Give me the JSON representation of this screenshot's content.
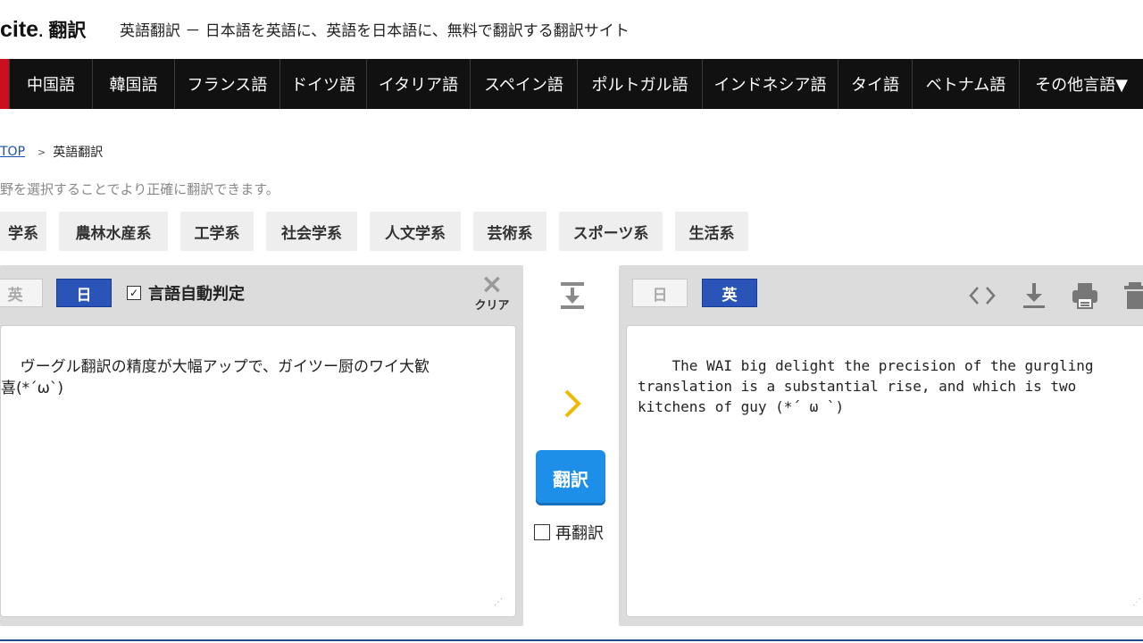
{
  "header": {
    "logo_main": "cite",
    "logo_dot": ".",
    "logo_sub": "翻訳",
    "tagline": "英語翻訳 － 日本語を英語に、英語を日本語に、無料で翻訳する翻訳サイト"
  },
  "nav": {
    "items": [
      {
        "label": "中国語"
      },
      {
        "label": "韓国語"
      },
      {
        "label": "フランス語"
      },
      {
        "label": "ドイツ語"
      },
      {
        "label": "イタリア語"
      },
      {
        "label": "スペイン語"
      },
      {
        "label": "ポルトガル語"
      },
      {
        "label": "インドネシア語"
      },
      {
        "label": "タイ語"
      },
      {
        "label": "ベトナム語"
      },
      {
        "label": "その他言語▼"
      }
    ],
    "accent_color": "#c8101e"
  },
  "breadcrumb": {
    "top": "TOP",
    "current": "英語翻訳"
  },
  "hint": "野を選択することでより正確に翻訳できます。",
  "categories": [
    "学系",
    "農林水産系",
    "工学系",
    "社会学系",
    "人文学系",
    "芸術系",
    "スポーツ系",
    "生活系"
  ],
  "source": {
    "lang_en": "英",
    "lang_ja": "日",
    "selected": "日",
    "auto_detect_label": "言語自動判定",
    "auto_detect_checked": true,
    "clear_label": "クリア",
    "text": "ヴーグル翻訳の精度が大幅アップで、ガイツー厨のワイ大歓\n喜(*´ω`)"
  },
  "target": {
    "lang_ja": "日",
    "lang_en": "英",
    "selected": "英",
    "text": "The WAI big delight the precision of the gurgling\ntranslation is a substantial rise, and which is two\nkitchens of guy (*´ ω `)",
    "tools": [
      "code-icon",
      "download-icon",
      "print-icon",
      "trash-icon"
    ]
  },
  "middle": {
    "translate_label": "翻訳",
    "retranslate_label": "再翻訳",
    "retranslate_checked": false
  },
  "colors": {
    "primary_blue": "#2b54b8",
    "translate_blue": "#1e8fe8",
    "arrow_yellow": "#f2b800"
  }
}
